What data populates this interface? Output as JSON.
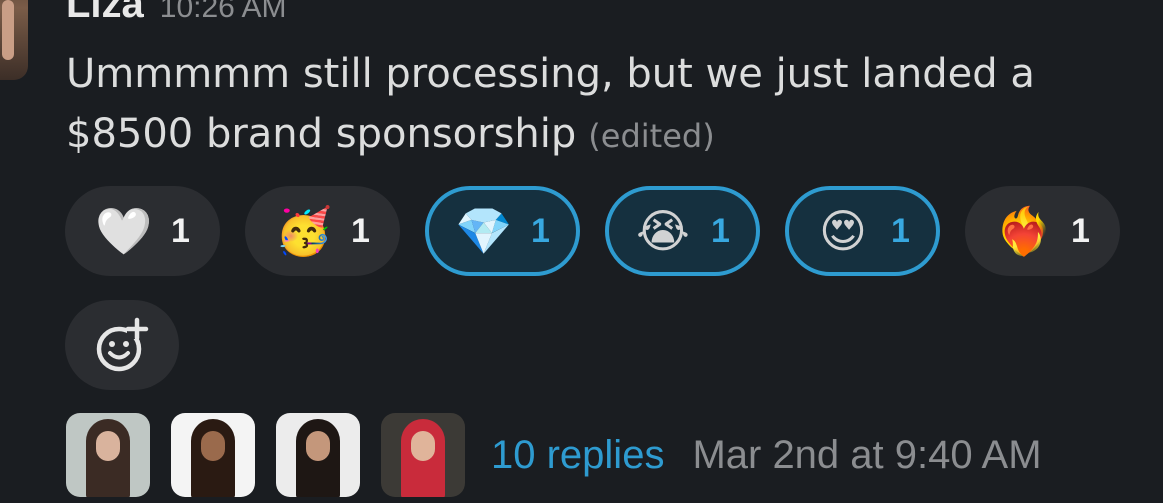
{
  "message": {
    "author": "Liza",
    "time": "10:26 AM",
    "text": "Ummmmm still processing, but we just landed a $8500 brand sponsorship",
    "edited_label": "(edited)"
  },
  "reactions": [
    {
      "emoji": "🤍",
      "count": "1",
      "active": false,
      "icon": "white-heart-icon"
    },
    {
      "emoji": "🥳",
      "count": "1",
      "active": false,
      "icon": "partying-face-icon"
    },
    {
      "emoji": "💎",
      "count": "1",
      "active": true,
      "icon": "gem-stone-icon"
    },
    {
      "emoji": "😭",
      "count": "1",
      "active": true,
      "icon": "loudly-crying-face-icon"
    },
    {
      "emoji": "😍",
      "count": "1",
      "active": true,
      "icon": "heart-eyes-face-icon"
    },
    {
      "emoji": "❤️‍🔥",
      "count": "1",
      "active": false,
      "icon": "heart-on-fire-icon"
    }
  ],
  "add_reaction": {
    "icon": "add-reaction-icon"
  },
  "thread": {
    "replies_label": "10 replies",
    "last_reply_time": "Mar 2nd at 9:40 AM"
  },
  "colors": {
    "background": "#1a1d21",
    "pill": "#2b2d31",
    "accent": "#2e9bd0",
    "muted_text": "#8b8d90"
  }
}
